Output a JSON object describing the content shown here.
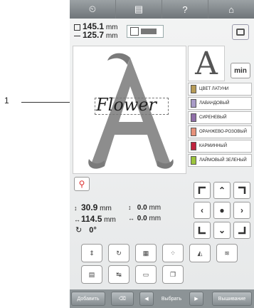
{
  "callout": {
    "number": "1"
  },
  "topbar": {
    "buttons": [
      {
        "icon": "clock-icon",
        "glyph": "⏲"
      },
      {
        "icon": "document-icon",
        "glyph": "▤"
      },
      {
        "icon": "help-icon",
        "glyph": "?"
      },
      {
        "icon": "home-icon",
        "glyph": "⌂"
      }
    ]
  },
  "size": {
    "height_value": "145.1",
    "width_value": "125.7",
    "unit": "mm"
  },
  "preview": {
    "text": "Flower",
    "letter": "A"
  },
  "font_thumb": {
    "letter": "A"
  },
  "min_button": {
    "label": "min"
  },
  "thread_colors": [
    {
      "label": "ЦВЕТ ЛАТУНИ",
      "color": "#b79b57"
    },
    {
      "label": "ЛАВАНДОВЫЙ",
      "color": "#a89bc7"
    },
    {
      "label": "СИРЕНЕВЫЙ",
      "color": "#8f6fa8"
    },
    {
      "label": "ОРАНЖЕВО-РОЗОВЫЙ",
      "color": "#e6917a"
    },
    {
      "label": "КАРМИННЫЙ",
      "color": "#c0233e"
    },
    {
      "label": "ЛАЙМОВЫЙ ЗЕЛЕНЫЙ",
      "color": "#9cc43c"
    }
  ],
  "measure": {
    "v_value": "30.9",
    "h_value": "114.5",
    "unit": "mm",
    "v_offset": "0.0",
    "h_offset": "0.0",
    "angle": "0°"
  },
  "dpad_glyphs": {
    "up": "⌃",
    "down": "⌄",
    "left": "‹",
    "right": "›",
    "center": "●"
  },
  "bottom": {
    "add_label": "Добавить",
    "select_label": "Выбрать",
    "embroider_label": "Вышивание"
  }
}
